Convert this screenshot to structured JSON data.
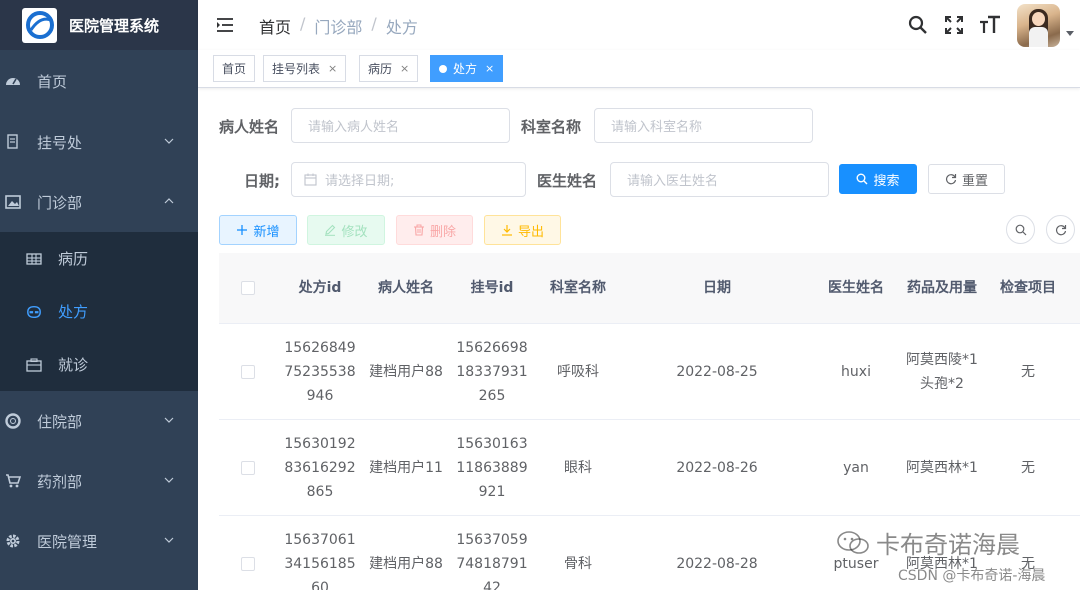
{
  "app": {
    "title": "医院管理系统"
  },
  "sidebar": {
    "items": [
      {
        "label": "首页",
        "icon": "dashboard-icon"
      },
      {
        "label": "挂号处",
        "icon": "form-icon"
      },
      {
        "label": "门诊部",
        "icon": "picture-icon"
      },
      {
        "label": "住院部",
        "icon": "lifebuoy-icon"
      },
      {
        "label": "药剂部",
        "icon": "cart-icon"
      },
      {
        "label": "医院管理",
        "icon": "gear-icon"
      }
    ],
    "submenu": [
      {
        "label": "病历",
        "icon": "table-icon"
      },
      {
        "label": "处方",
        "icon": "mask-icon"
      },
      {
        "label": "就诊",
        "icon": "briefcase-icon"
      }
    ]
  },
  "breadcrumb": {
    "home": "首页",
    "dept": "门诊部",
    "page": "处方",
    "sep": "/"
  },
  "tags": [
    {
      "label": "首页"
    },
    {
      "label": "挂号列表",
      "close": "×"
    },
    {
      "label": "病历",
      "close": "×"
    },
    {
      "label": "处方",
      "close": "×"
    }
  ],
  "search": {
    "patient_label": "病人姓名",
    "patient_placeholder": "请输入病人姓名",
    "dept_label": "科室名称",
    "dept_placeholder": "请输入科室名称",
    "date_label": "日期;",
    "date_placeholder": "请选择日期;",
    "doctor_label": "医生姓名",
    "doctor_placeholder": "请输入医生姓名",
    "search_btn": "搜索",
    "reset_btn": "重置"
  },
  "toolbar": {
    "add": "新增",
    "edit": "修改",
    "delete": "删除",
    "export": "导出"
  },
  "table": {
    "headers": [
      "处方id",
      "病人姓名",
      "挂号id",
      "科室名称",
      "日期",
      "医生姓名",
      "药品及用量",
      "检查项目"
    ],
    "rows": [
      {
        "id": "1562684975235538946",
        "patient": "建档用户88",
        "reg": "1562669818337931265",
        "dept": "呼吸科",
        "date": "2022-08-25",
        "doctor": "huxi",
        "drug": "阿莫西陵*1 头孢*2",
        "exam": "无"
      },
      {
        "id": "1563019283616292865",
        "patient": "建档用户11",
        "reg": "1563016311863889921",
        "dept": "眼科",
        "date": "2022-08-26",
        "doctor": "yan",
        "drug": "阿莫西林*1",
        "exam": "无"
      },
      {
        "id": "156370613415618560",
        "patient": "建档用户88",
        "reg": "156370597481879142",
        "dept": "骨科",
        "date": "2022-08-28",
        "doctor": "ptuser",
        "drug": "阿莫西林*1",
        "exam": "无"
      }
    ]
  },
  "watermark": {
    "line1": "卡布奇诺海晨",
    "line2": "CSDN @卡布奇诺-海晨"
  },
  "colors": {
    "sidebar": "#304156",
    "primary": "#1890ff",
    "active_menu": "#409eff"
  }
}
